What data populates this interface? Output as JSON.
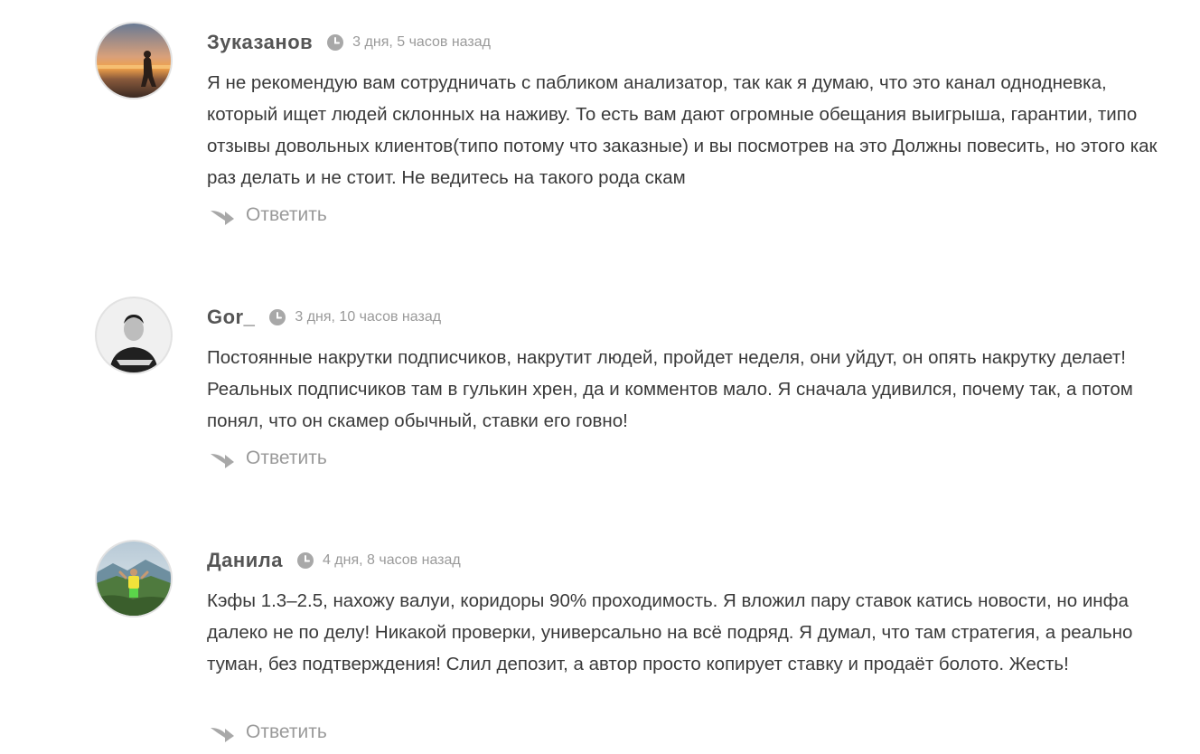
{
  "comments": [
    {
      "author": "Зуказанов",
      "time": "3 дня, 5 часов назад",
      "text": "Я не рекомендую вам сотрудничать с пабликом анализатор, так как я думаю, что это канал однодневка, который ищет людей склонных на наживу. То есть вам дают огромные обещания выигрыша, гарантии, типо отзывы довольных клиентов(типо потому что заказные) и вы посмотрев на это Должны повесить, но этого как раз делать и не стоит. Не ведитесь на такого рода скам",
      "reply_label": "Ответить",
      "avatar_icon": "sunset-person-photo"
    },
    {
      "author": "Gor_",
      "time": "3 дня, 10 часов назад",
      "text": "Постоянные накрутки подписчиков, накрутит людей, пройдет неделя, они уйдут, он опять накрутку делает! Реальных подписчиков там в гулькин хрен, да и комментов мало. Я сначала удивился, почему так, а потом понял, что он скамер обычный, ставки его говно!",
      "reply_label": "Ответить",
      "avatar_icon": "bw-portrait-photo"
    },
    {
      "author": "Данила",
      "time": "4 дня, 8 часов назад",
      "text": "Кэфы 1.3–2.5, нахожу валуи, коридоры 90% проходимость. Я вложил пару ставок катись новости, но инфа далеко не по делу! Никакой проверки, универсально на всё подряд. Я думал, что там стратегия, а реально туман, без подтверждения! Слил депозит, а автор просто копирует ставку и продаёт болото. Жесть!",
      "reply_label": "Ответить",
      "avatar_icon": "mountain-person-photo"
    }
  ],
  "icons": {
    "clock": "clock-icon",
    "reply": "reply-arrow-icon"
  },
  "colors": {
    "author": "#555555",
    "meta": "#9a9a9a",
    "text": "#3a3a3a"
  }
}
